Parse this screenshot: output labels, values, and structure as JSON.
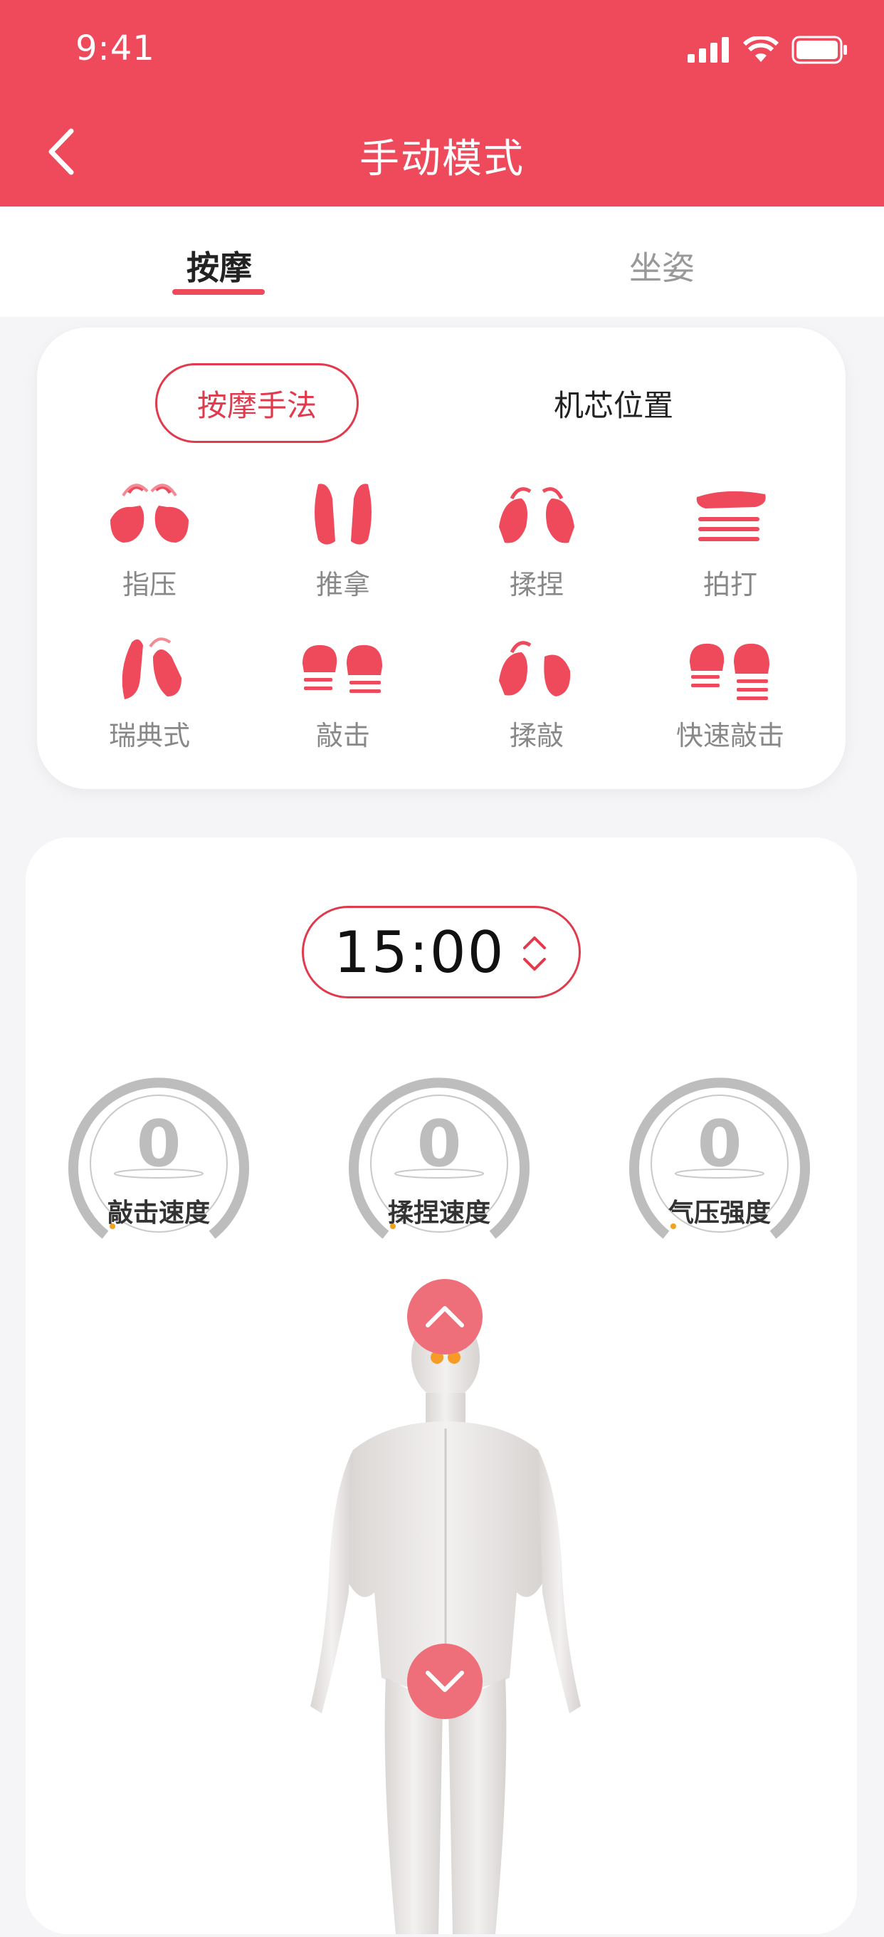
{
  "status": {
    "time": "9:41"
  },
  "header": {
    "title": "手动模式"
  },
  "tabs": [
    {
      "label": "按摩",
      "active": true
    },
    {
      "label": "坐姿",
      "active": false
    }
  ],
  "technique_card": {
    "segments": [
      {
        "label": "按摩手法",
        "active": true
      },
      {
        "label": "机芯位置",
        "active": false
      }
    ],
    "techniques": [
      {
        "label": "指压",
        "icon": "finger-press-icon"
      },
      {
        "label": "推拿",
        "icon": "tuina-icon"
      },
      {
        "label": "揉捏",
        "icon": "knead-icon"
      },
      {
        "label": "拍打",
        "icon": "pat-icon"
      },
      {
        "label": "瑞典式",
        "icon": "swedish-icon"
      },
      {
        "label": "敲击",
        "icon": "tap-icon"
      },
      {
        "label": "揉敲",
        "icon": "knead-tap-icon"
      },
      {
        "label": "快速敲击",
        "icon": "fast-tap-icon"
      }
    ]
  },
  "control": {
    "timer": "15:00",
    "gauges": [
      {
        "label": "敲击速度",
        "value": "0"
      },
      {
        "label": "揉捏速度",
        "value": "0"
      },
      {
        "label": "气压强度",
        "value": "0"
      }
    ]
  },
  "colors": {
    "accent": "#ee4a5b",
    "accent_dark": "#e23a4d",
    "gauge_track": "#bdbdbd"
  }
}
